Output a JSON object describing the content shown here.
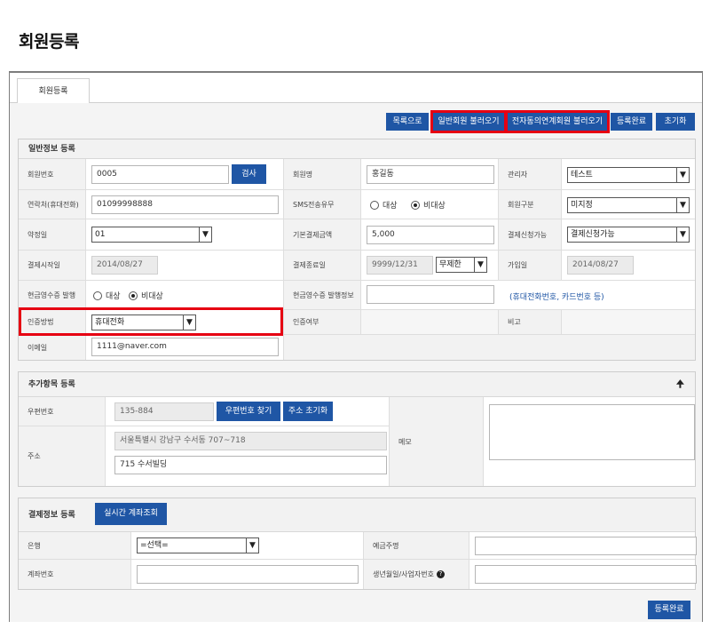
{
  "page": {
    "title": "회원등록"
  },
  "tab": {
    "label": "회원등록"
  },
  "toolbar": {
    "list": "목록으로",
    "load_general": "일반회원 불러오기",
    "load_esign": "전자동의연계회원 불러오기",
    "register_done": "등록완료",
    "reset": "초기화"
  },
  "general": {
    "heading": "일반정보 등록",
    "member_no": {
      "label": "회원번호",
      "value": "0005",
      "search": "검사"
    },
    "member_name": {
      "label": "회원명",
      "value": "홍길동"
    },
    "manager": {
      "label": "관리자",
      "value": "테스트"
    },
    "phone": {
      "label": "연락처(휴대전화)",
      "value": "01099998888"
    },
    "sms": {
      "label": "SMS전송유무",
      "opt1": "대상",
      "opt2": "비대상",
      "selected": "비대상"
    },
    "member_type": {
      "label": "회원구분",
      "value": "미지정"
    },
    "pay_day": {
      "label": "약정일",
      "value": "01"
    },
    "base_amount": {
      "label": "기본결제금액",
      "value": "5,000"
    },
    "pay_status": {
      "label": "결제신청가능",
      "value": "결제신청가능"
    },
    "pay_start": {
      "label": "결제시작일",
      "value": "2014/08/27"
    },
    "pay_end": {
      "label": "결제종료일",
      "value": "9999/12/31",
      "select": "무제한"
    },
    "join_date": {
      "label": "가입일",
      "value": "2014/08/27"
    },
    "receipt": {
      "label": "현금영수증 발행",
      "opt1": "대상",
      "opt2": "비대상",
      "selected": "비대상"
    },
    "receipt_info": {
      "label": "현금영수증 발행정보",
      "value": "",
      "hint": "(휴대전화번호, 카드번호 등)"
    },
    "auth_method": {
      "label": "인증방법",
      "value": "휴대전화"
    },
    "auth_status": {
      "label": "인증여부"
    },
    "note": {
      "label": "비고"
    },
    "email": {
      "label": "이메일",
      "value": "1111@naver.com"
    }
  },
  "extra": {
    "heading": "추가항목 등록",
    "zip": {
      "label": "우편번호",
      "value": "135-884",
      "find": "우편번호 찾기",
      "reset": "주소 초기화"
    },
    "address": {
      "label": "주소",
      "line1": "서울특별시 강남구 수서동 707~718",
      "line2": "715 수서빌딩"
    },
    "memo": {
      "label": "메모",
      "value": ""
    }
  },
  "payment": {
    "heading": "결제정보 등록",
    "realtime_btn": "실시간 계좌조회",
    "bank": {
      "label": "은행",
      "value": "=선택="
    },
    "depositor": {
      "label": "예금주명",
      "value": ""
    },
    "account": {
      "label": "계좌번호",
      "value": ""
    },
    "birth": {
      "label": "생년월일/사업자번호",
      "value": ""
    }
  },
  "footer": {
    "register_done": "등록완료"
  },
  "colors": {
    "primary": "#1f56a5",
    "highlight": "#e60012",
    "label_bg": "#f2f2f2"
  }
}
